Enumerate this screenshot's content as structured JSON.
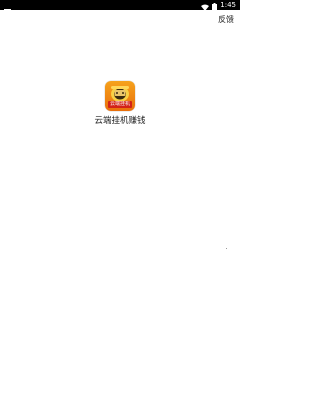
{
  "status_bar": {
    "time": "1:45",
    "left_icon": "notification-icon",
    "right_icons": [
      "wifi-icon",
      "battery-icon"
    ]
  },
  "header": {
    "feedback_label": "反馈"
  },
  "app": {
    "name": "云端挂机赚钱",
    "icon_badge_text": "云端挂机",
    "icon_colors": {
      "background_top": "#f6a21c",
      "background_bottom": "#e86f0c",
      "badge": "#d32218"
    }
  },
  "colors": {
    "status_bar_bg": "#000000",
    "page_bg": "#ffffff",
    "text": "#222222"
  }
}
